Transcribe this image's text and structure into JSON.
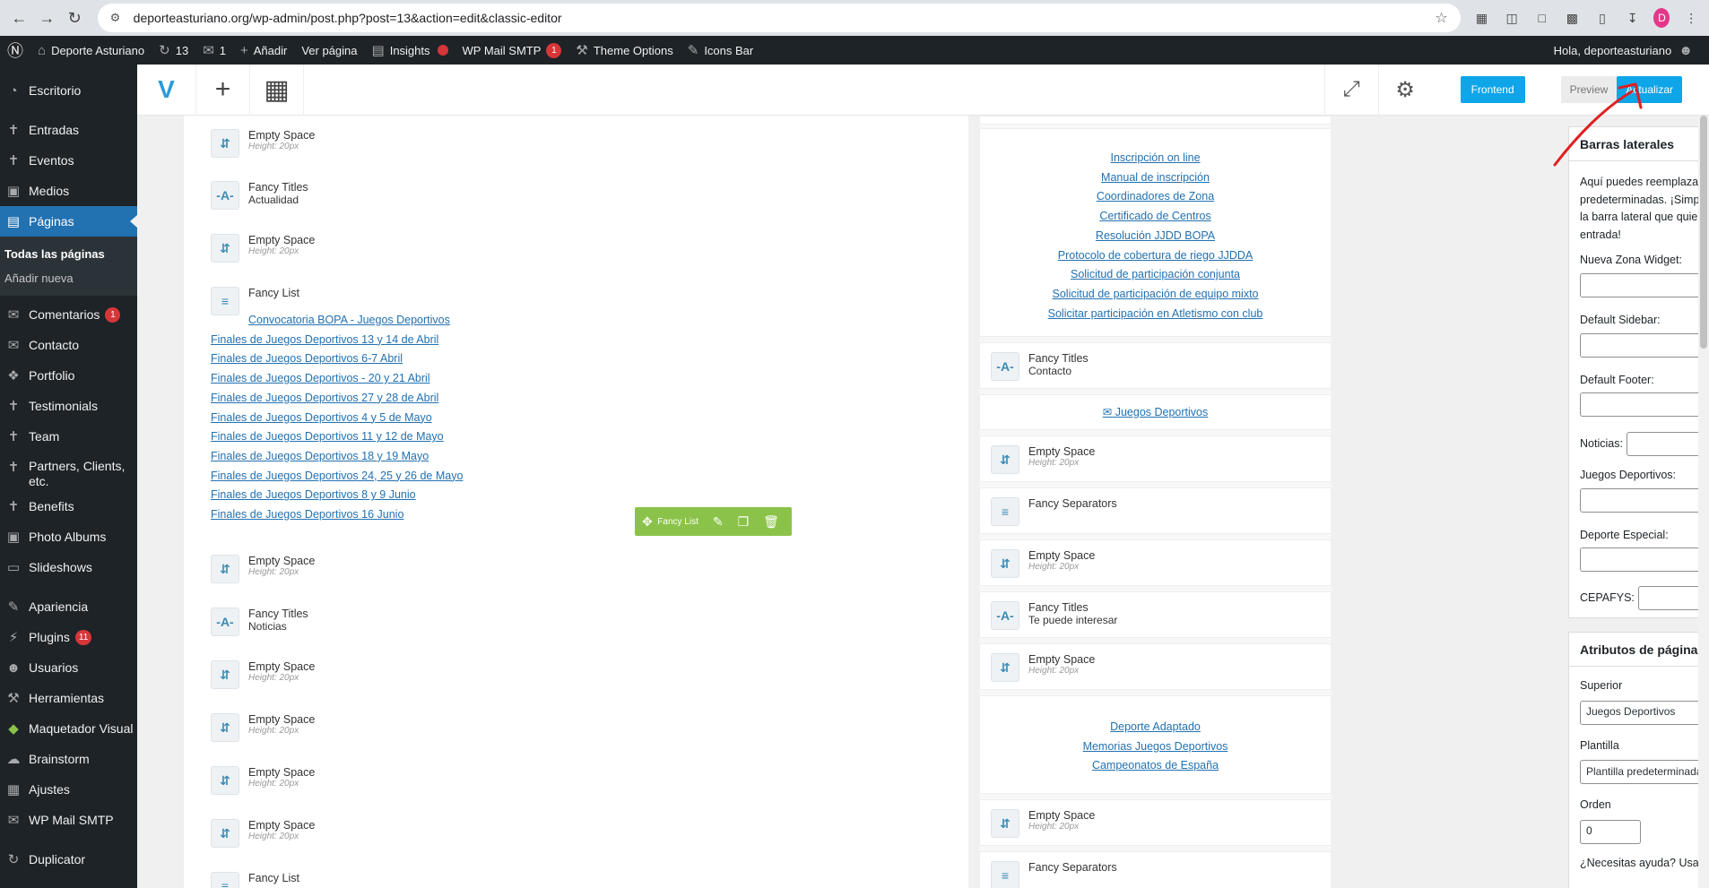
{
  "browser": {
    "url": "deporteasturiano.org/wp-admin/post.php?post=13&action=edit&classic-editor",
    "profile_initial": "D"
  },
  "adminbar": {
    "site_name": "Deporte Asturiano",
    "updates_count": "13",
    "comments_count": "1",
    "new_label": "Añadir",
    "view_label": "Ver página",
    "insights_label": "Insights",
    "smtp_label": "WP Mail SMTP",
    "smtp_badge": "1",
    "theme_options_label": "Theme Options",
    "icons_bar_label": "Icons Bar",
    "greeting": "Hola, deporteasturiano"
  },
  "sidebar": {
    "items": [
      {
        "label": "Escritorio",
        "icon": "dashboard-icon"
      },
      {
        "label": "Entradas",
        "icon": "pin-icon"
      },
      {
        "label": "Eventos",
        "icon": "pin-icon"
      },
      {
        "label": "Medios",
        "icon": "media-icon"
      },
      {
        "label": "Páginas",
        "icon": "pages-icon"
      },
      {
        "label": "Comentarios",
        "icon": "comment-icon",
        "badge": "1"
      },
      {
        "label": "Contacto",
        "icon": "mail-icon"
      },
      {
        "label": "Portfolio",
        "icon": "portfolio-icon"
      },
      {
        "label": "Testimonials",
        "icon": "testimonial-icon"
      },
      {
        "label": "Team",
        "icon": "pin-icon"
      },
      {
        "label": "Partners, Clients, etc.",
        "icon": "partners-icon"
      },
      {
        "label": "Benefits",
        "icon": "benefits-icon"
      },
      {
        "label": "Photo Albums",
        "icon": "album-icon"
      },
      {
        "label": "Slideshows",
        "icon": "slideshow-icon"
      },
      {
        "label": "Apariencia",
        "icon": "brush-icon"
      },
      {
        "label": "Plugins",
        "icon": "plugin-icon",
        "badge": "11"
      },
      {
        "label": "Usuarios",
        "icon": "users-icon"
      },
      {
        "label": "Herramientas",
        "icon": "tools-icon"
      },
      {
        "label": "Maquetador Visual",
        "icon": "vc-icon"
      },
      {
        "label": "Brainstorm",
        "icon": "brainstorm-icon"
      },
      {
        "label": "Ajustes",
        "icon": "settings-icon"
      },
      {
        "label": "WP Mail SMTP",
        "icon": "mail-icon"
      },
      {
        "label": "Duplicator",
        "icon": "duplicator-icon"
      }
    ],
    "sub_current": "Todas las páginas",
    "sub_add": "Añadir nueva"
  },
  "toolbar": {
    "frontend_label": "Frontend",
    "preview_label": "Preview",
    "update_label": "Actualizar"
  },
  "col1": {
    "empty_space_title": "Empty Space",
    "empty_space_meta": "Height: 20px",
    "fancy_titles_title": "Fancy Titles",
    "fancy_list_title": "Fancy List",
    "title_actualidad": "Actualidad",
    "title_noticias": "Noticias",
    "fancy_links": [
      "Convocatoria BOPA - Juegos Deportivos",
      "Finales de Juegos Deportivos 13 y 14 de Abril",
      "Finales de Juegos Deportivos 6-7 Abril",
      "Finales de Juegos Deportivos - 20 y 21 Abril",
      "Finales de Juegos Deportivos 27 y 28 de Abril",
      "Finales de Juegos Deportivos 4 y 5 de Mayo",
      "Finales de Juegos Deportivos 11 y 12 de Mayo",
      "Finales de Juegos Deportivos 18 y 19 Mayo",
      "Finales de Juegos Deportivos 24, 25 y 26 de Mayo",
      "Finales de Juegos Deportivos 8 y 9 Junio",
      "Finales de Juegos Deportivos 16 Junio"
    ],
    "floatbar_label": "Fancy List"
  },
  "col2": {
    "links_top": [
      "Inscripción on line",
      "Manual de inscripción",
      "Coordinadores de Zona",
      "Certificado de Centros",
      "Resolución JJDD BOPA",
      "Protocolo de cobertura de riego JJDDA",
      "Solicitud de participación conjunta",
      "Solicitud de participación de equipo mixto",
      "Solicitar participación en Atletismo con club"
    ],
    "title_contacto": "Contacto",
    "mail_link": " Juegos Deportivos",
    "fancy_separators_title": "Fancy Separators",
    "title_te_puede": "Te puede interesar",
    "links_bottom": [
      "Deporte Adaptado",
      "Memorias Juegos Deportivos",
      "Campeonatos de España"
    ]
  },
  "rsb": {
    "barras_title": "Barras laterales",
    "barras_desc": "Aquí puedes reemplazar las barras laterales predeterminadas. ¡Simplemente selecciona la barra lateral que quieras mostrar para esta entrada!",
    "nueva_zona": "Nueva Zona Widget:",
    "default_sidebar": "Default Sidebar:",
    "default_footer": "Default Footer:",
    "noticias": "Noticias:",
    "juegos": "Juegos Deportivos:",
    "deporte_especial": "Deporte Especial:",
    "cepafys": "CEPAFYS:",
    "atributos_title": "Atributos de página",
    "superior_label": "Superior",
    "superior_value": "Juegos Deportivos",
    "plantilla_label": "Plantilla",
    "plantilla_value": "Plantilla predeterminada",
    "orden_label": "Orden",
    "orden_value": "0",
    "help_text": "¿Necesitas ayuda? Usa la pestaña de ayuda"
  }
}
